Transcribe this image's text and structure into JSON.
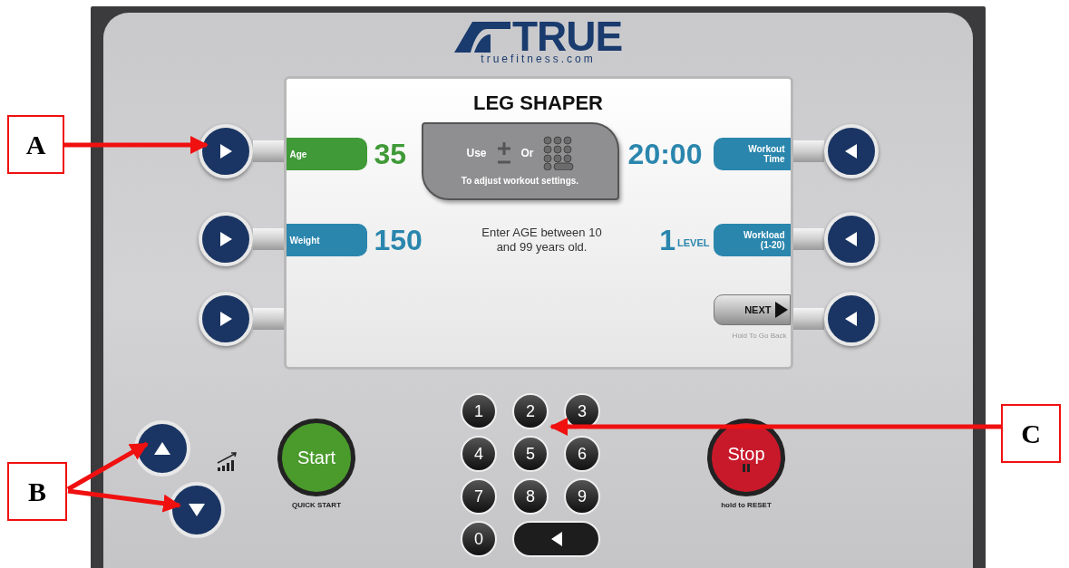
{
  "logo": {
    "brand": "TRUE",
    "url": "truefitness.com"
  },
  "display": {
    "title": "LEG SHAPER",
    "left_fields": [
      {
        "label": "Age",
        "value": "35",
        "color": "#3f9a37"
      },
      {
        "label": "Weight",
        "value": "150",
        "color": "#2a86ad"
      }
    ],
    "right_fields": [
      {
        "label": "Workout Time",
        "value": "20:00"
      },
      {
        "label": "Workload (1-20)",
        "value": "1",
        "unit": "LEVEL"
      }
    ],
    "hint": {
      "use": "Use",
      "or": "Or",
      "text": "To adjust workout settings."
    },
    "prompt": "Enter AGE between 10 and 99 years old.",
    "next": {
      "label": "NEXT",
      "hint": "Hold To Go Back"
    }
  },
  "start": {
    "label": "Start",
    "caption": "QUICK START"
  },
  "keypad": [
    "1",
    "2",
    "3",
    "4",
    "5",
    "6",
    "7",
    "8",
    "9",
    "0"
  ],
  "stop": {
    "label": "Stop",
    "caption": "hold to RESET"
  },
  "annotations": [
    {
      "label": "A"
    },
    {
      "label": "B"
    },
    {
      "label": "C"
    }
  ]
}
